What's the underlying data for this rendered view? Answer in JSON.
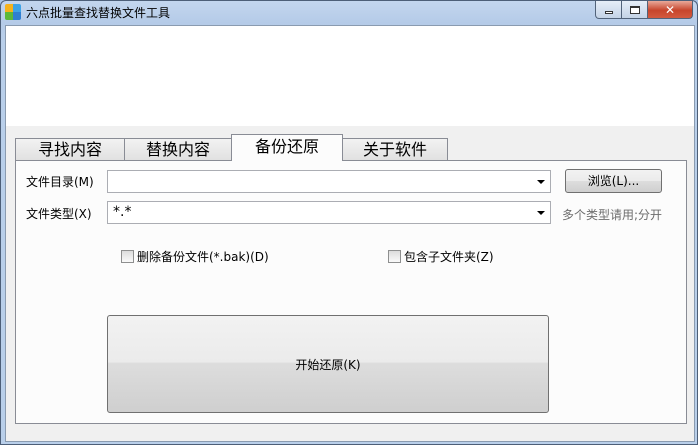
{
  "window": {
    "title": "六点批量查找替换文件工具",
    "icon": "app-grid-icon"
  },
  "tabs": [
    {
      "label": "寻找内容",
      "active": false
    },
    {
      "label": "替换内容",
      "active": false
    },
    {
      "label": "备份还原",
      "active": true
    },
    {
      "label": "关于软件",
      "active": false
    }
  ],
  "form": {
    "dir_label": "文件目录(M)",
    "dir_value": "",
    "browse_label": "浏览(L)...",
    "type_label": "文件类型(X)",
    "type_value": "*.*",
    "type_hint": "多个类型请用;分开",
    "delete_backup_label": "删除备份文件(*.bak)(D)",
    "delete_backup_checked": false,
    "include_subfolders_label": "包含子文件夹(Z)",
    "include_subfolders_checked": false,
    "start_restore_label": "开始还原(K)"
  }
}
